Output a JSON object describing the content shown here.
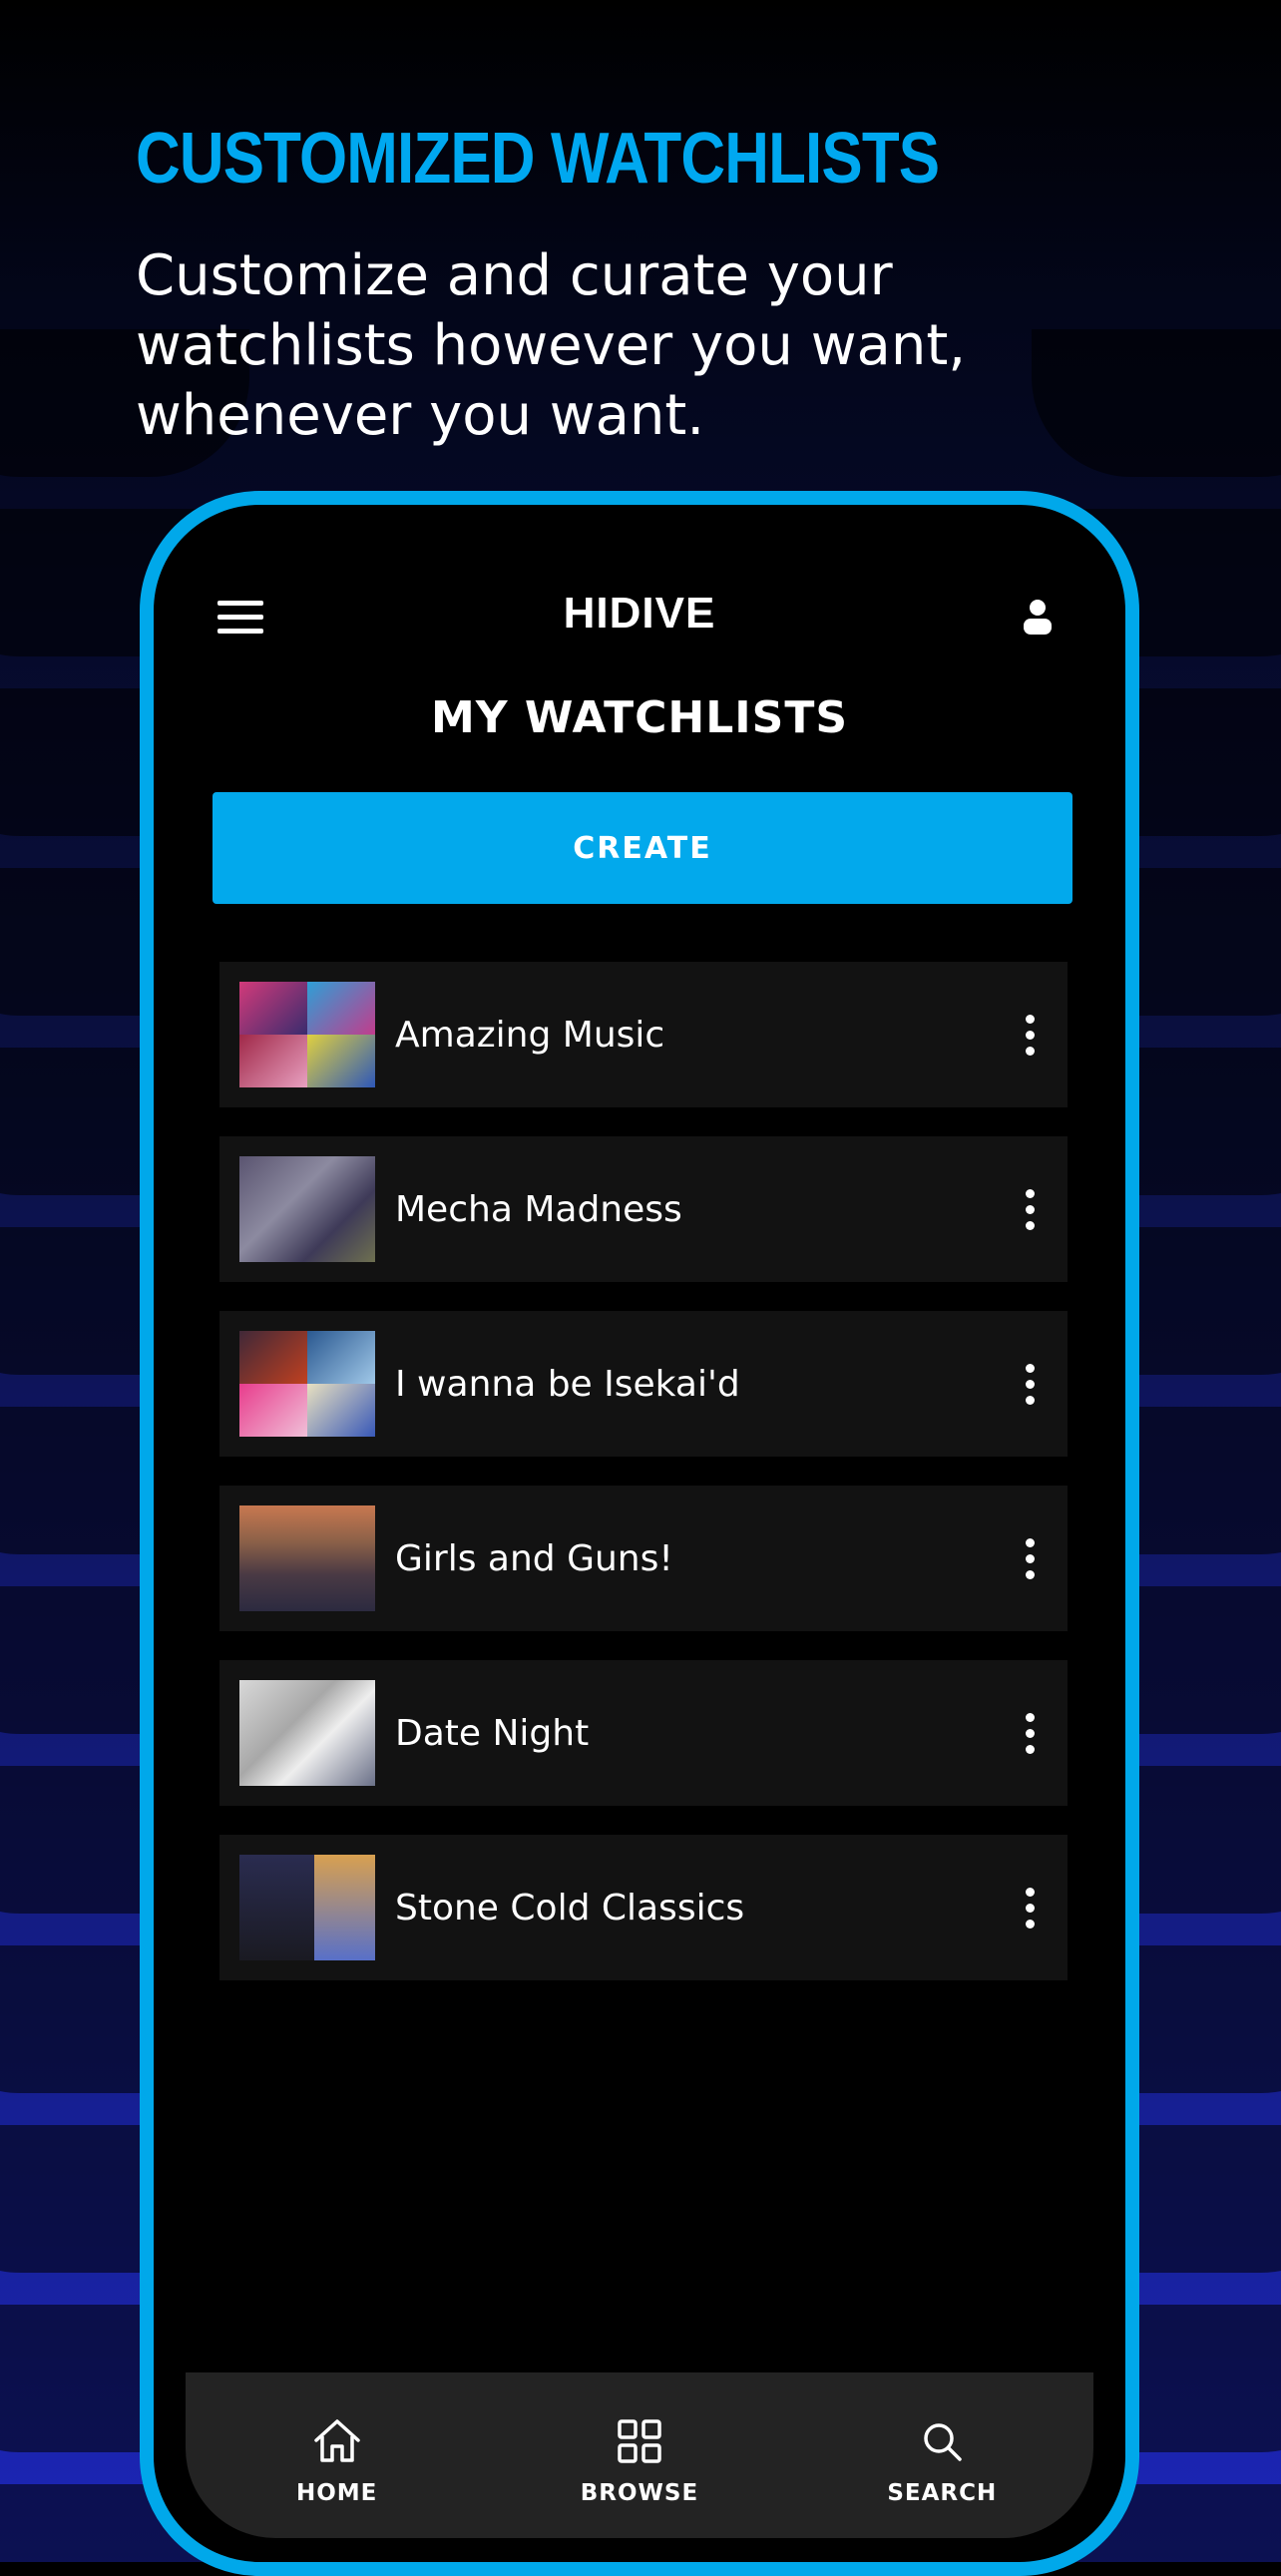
{
  "promo": {
    "heading": "CUSTOMIZED WATCHLISTS",
    "subheading": "Customize and curate your watchlists however you want, whenever you want."
  },
  "app": {
    "logo": "HIDIVE",
    "page_title": "MY WATCHLISTS",
    "create_label": "CREATE",
    "watchlists": [
      {
        "label": "Amazing Music"
      },
      {
        "label": "Mecha Madness"
      },
      {
        "label": "I wanna be Isekai'd"
      },
      {
        "label": "Girls and Guns!"
      },
      {
        "label": "Date Night"
      },
      {
        "label": "Stone Cold Classics"
      }
    ],
    "nav": [
      {
        "label": "HOME",
        "icon": "home-icon"
      },
      {
        "label": "BROWSE",
        "icon": "grid-icon"
      },
      {
        "label": "SEARCH",
        "icon": "search-icon"
      }
    ]
  },
  "colors": {
    "accent": "#00a8f0",
    "button": "#02a9ec",
    "card": "#121212",
    "nav": "#232323"
  }
}
